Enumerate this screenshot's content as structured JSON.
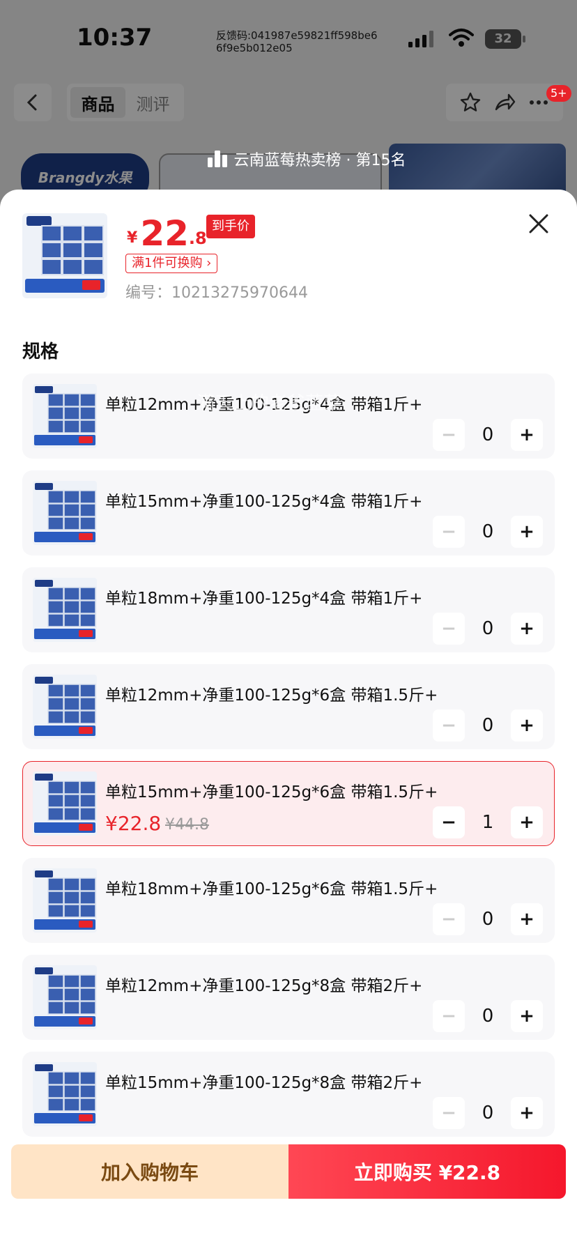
{
  "status_bar": {
    "time": "10:37",
    "feedback_code": "反馈码:041987e59821ff598be66f9e5b012e05",
    "battery": "32",
    "icons": [
      "signal-icon",
      "wifi-icon",
      "battery-icon"
    ]
  },
  "nav": {
    "tabs": [
      "商品",
      "测评"
    ],
    "active_tab": "商品",
    "badge": "5+",
    "icons": [
      "back-icon",
      "star-icon",
      "share-icon",
      "more-icon"
    ]
  },
  "background": {
    "brand": "Brangdy水果",
    "rank_text": "云南蓝莓热卖榜 · 第15名"
  },
  "product": {
    "price_symbol": "¥",
    "price_int": "22",
    "price_dec": ".8",
    "price_tag": "到手价",
    "promo": "满1件可换购 ›",
    "sku": "编号：10213275970644"
  },
  "section_title": "规格",
  "variants": [
    {
      "label": "单粒12mm+净重100-125g*4盒 带箱1斤+",
      "qty": "0",
      "selected": false
    },
    {
      "label": "单粒15mm+净重100-125g*4盒 带箱1斤+",
      "qty": "0",
      "selected": false
    },
    {
      "label": "单粒18mm+净重100-125g*4盒 带箱1斤+",
      "qty": "0",
      "selected": false
    },
    {
      "label": "单粒12mm+净重100-125g*6盒 带箱1.5斤+",
      "qty": "0",
      "selected": false
    },
    {
      "label": "单粒15mm+净重100-125g*6盒 带箱1.5斤+",
      "qty": "1",
      "selected": true,
      "price": "¥22.8",
      "original_price": "¥44.8"
    },
    {
      "label": "单粒18mm+净重100-125g*6盒 带箱1.5斤+",
      "qty": "0",
      "selected": false
    },
    {
      "label": "单粒12mm+净重100-125g*8盒 带箱2斤+",
      "qty": "0",
      "selected": false
    },
    {
      "label": "单粒15mm+净重100-125g*8盒 带箱2斤+",
      "qty": "0",
      "selected": false
    }
  ],
  "stepper": {
    "minus": "−",
    "plus": "+"
  },
  "cta": {
    "add_to_cart": "加入购物车",
    "buy_now": "立即购买 ¥22.8"
  },
  "watermark": "满天上的老爸蓝菜",
  "colors": {
    "accent_red": "#e8232a",
    "cart_bg": "#ffe4c6",
    "cart_text": "#7a4a12",
    "selected_bg": "#fdecee",
    "card_bg": "#f7f7f9"
  }
}
